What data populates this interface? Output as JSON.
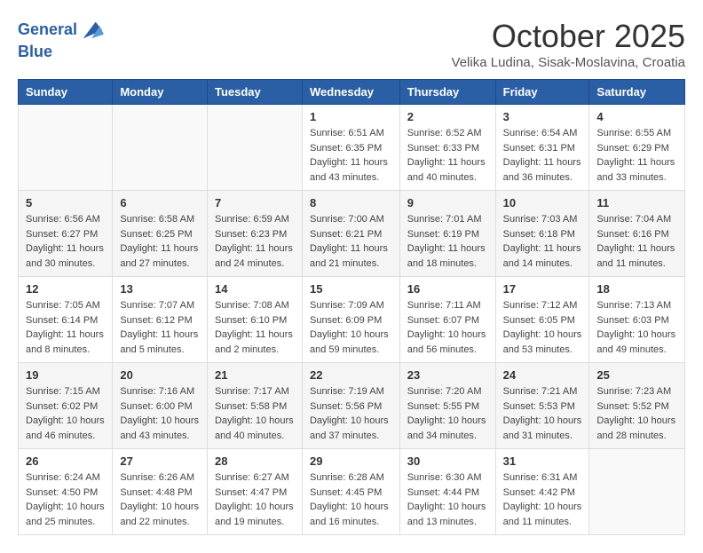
{
  "header": {
    "logo_line1": "General",
    "logo_line2": "Blue",
    "month": "October 2025",
    "location": "Velika Ludina, Sisak-Moslavina, Croatia"
  },
  "weekdays": [
    "Sunday",
    "Monday",
    "Tuesday",
    "Wednesday",
    "Thursday",
    "Friday",
    "Saturday"
  ],
  "weeks": [
    [
      {
        "day": "",
        "info": ""
      },
      {
        "day": "",
        "info": ""
      },
      {
        "day": "",
        "info": ""
      },
      {
        "day": "1",
        "info": "Sunrise: 6:51 AM\nSunset: 6:35 PM\nDaylight: 11 hours\nand 43 minutes."
      },
      {
        "day": "2",
        "info": "Sunrise: 6:52 AM\nSunset: 6:33 PM\nDaylight: 11 hours\nand 40 minutes."
      },
      {
        "day": "3",
        "info": "Sunrise: 6:54 AM\nSunset: 6:31 PM\nDaylight: 11 hours\nand 36 minutes."
      },
      {
        "day": "4",
        "info": "Sunrise: 6:55 AM\nSunset: 6:29 PM\nDaylight: 11 hours\nand 33 minutes."
      }
    ],
    [
      {
        "day": "5",
        "info": "Sunrise: 6:56 AM\nSunset: 6:27 PM\nDaylight: 11 hours\nand 30 minutes."
      },
      {
        "day": "6",
        "info": "Sunrise: 6:58 AM\nSunset: 6:25 PM\nDaylight: 11 hours\nand 27 minutes."
      },
      {
        "day": "7",
        "info": "Sunrise: 6:59 AM\nSunset: 6:23 PM\nDaylight: 11 hours\nand 24 minutes."
      },
      {
        "day": "8",
        "info": "Sunrise: 7:00 AM\nSunset: 6:21 PM\nDaylight: 11 hours\nand 21 minutes."
      },
      {
        "day": "9",
        "info": "Sunrise: 7:01 AM\nSunset: 6:19 PM\nDaylight: 11 hours\nand 18 minutes."
      },
      {
        "day": "10",
        "info": "Sunrise: 7:03 AM\nSunset: 6:18 PM\nDaylight: 11 hours\nand 14 minutes."
      },
      {
        "day": "11",
        "info": "Sunrise: 7:04 AM\nSunset: 6:16 PM\nDaylight: 11 hours\nand 11 minutes."
      }
    ],
    [
      {
        "day": "12",
        "info": "Sunrise: 7:05 AM\nSunset: 6:14 PM\nDaylight: 11 hours\nand 8 minutes."
      },
      {
        "day": "13",
        "info": "Sunrise: 7:07 AM\nSunset: 6:12 PM\nDaylight: 11 hours\nand 5 minutes."
      },
      {
        "day": "14",
        "info": "Sunrise: 7:08 AM\nSunset: 6:10 PM\nDaylight: 11 hours\nand 2 minutes."
      },
      {
        "day": "15",
        "info": "Sunrise: 7:09 AM\nSunset: 6:09 PM\nDaylight: 10 hours\nand 59 minutes."
      },
      {
        "day": "16",
        "info": "Sunrise: 7:11 AM\nSunset: 6:07 PM\nDaylight: 10 hours\nand 56 minutes."
      },
      {
        "day": "17",
        "info": "Sunrise: 7:12 AM\nSunset: 6:05 PM\nDaylight: 10 hours\nand 53 minutes."
      },
      {
        "day": "18",
        "info": "Sunrise: 7:13 AM\nSunset: 6:03 PM\nDaylight: 10 hours\nand 49 minutes."
      }
    ],
    [
      {
        "day": "19",
        "info": "Sunrise: 7:15 AM\nSunset: 6:02 PM\nDaylight: 10 hours\nand 46 minutes."
      },
      {
        "day": "20",
        "info": "Sunrise: 7:16 AM\nSunset: 6:00 PM\nDaylight: 10 hours\nand 43 minutes."
      },
      {
        "day": "21",
        "info": "Sunrise: 7:17 AM\nSunset: 5:58 PM\nDaylight: 10 hours\nand 40 minutes."
      },
      {
        "day": "22",
        "info": "Sunrise: 7:19 AM\nSunset: 5:56 PM\nDaylight: 10 hours\nand 37 minutes."
      },
      {
        "day": "23",
        "info": "Sunrise: 7:20 AM\nSunset: 5:55 PM\nDaylight: 10 hours\nand 34 minutes."
      },
      {
        "day": "24",
        "info": "Sunrise: 7:21 AM\nSunset: 5:53 PM\nDaylight: 10 hours\nand 31 minutes."
      },
      {
        "day": "25",
        "info": "Sunrise: 7:23 AM\nSunset: 5:52 PM\nDaylight: 10 hours\nand 28 minutes."
      }
    ],
    [
      {
        "day": "26",
        "info": "Sunrise: 6:24 AM\nSunset: 4:50 PM\nDaylight: 10 hours\nand 25 minutes."
      },
      {
        "day": "27",
        "info": "Sunrise: 6:26 AM\nSunset: 4:48 PM\nDaylight: 10 hours\nand 22 minutes."
      },
      {
        "day": "28",
        "info": "Sunrise: 6:27 AM\nSunset: 4:47 PM\nDaylight: 10 hours\nand 19 minutes."
      },
      {
        "day": "29",
        "info": "Sunrise: 6:28 AM\nSunset: 4:45 PM\nDaylight: 10 hours\nand 16 minutes."
      },
      {
        "day": "30",
        "info": "Sunrise: 6:30 AM\nSunset: 4:44 PM\nDaylight: 10 hours\nand 13 minutes."
      },
      {
        "day": "31",
        "info": "Sunrise: 6:31 AM\nSunset: 4:42 PM\nDaylight: 10 hours\nand 11 minutes."
      },
      {
        "day": "",
        "info": ""
      }
    ]
  ]
}
